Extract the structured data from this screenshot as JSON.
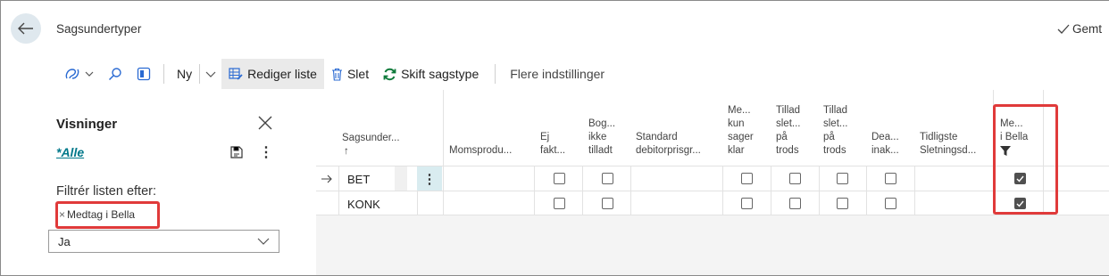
{
  "header": {
    "title": "Sagsundertyper",
    "saved_label": "Gemt"
  },
  "toolbar": {
    "new_label": "Ny",
    "edit_list_label": "Rediger liste",
    "delete_label": "Slet",
    "switch_type_label": "Skift sagstype",
    "more_settings_label": "Flere indstillinger"
  },
  "views": {
    "title": "Visninger",
    "active_view": "*Alle",
    "filter_label": "Filtrér listen efter:",
    "filter_chip": "Medtag i Bella",
    "filter_value": "Ja"
  },
  "columns": [
    {
      "key": "code",
      "label_lines": [
        "Sagsunder...",
        "↑"
      ]
    },
    {
      "key": "moms",
      "label_lines": [
        "Momsprodu..."
      ]
    },
    {
      "key": "ej_fakt",
      "label_lines": [
        "Ej",
        "fakt..."
      ]
    },
    {
      "key": "bog_ikke",
      "label_lines": [
        "Bog...",
        "ikke",
        "tilladt"
      ]
    },
    {
      "key": "std_debitor",
      "label_lines": [
        "Standard",
        "debitorprisgr..."
      ]
    },
    {
      "key": "me_kun",
      "label_lines": [
        "Me...",
        "kun",
        "sager",
        "klar"
      ]
    },
    {
      "key": "tillad_1",
      "label_lines": [
        "Tillad",
        "slet...",
        "på",
        "trods"
      ]
    },
    {
      "key": "tillad_2",
      "label_lines": [
        "Tillad",
        "slet...",
        "på",
        "trods"
      ]
    },
    {
      "key": "dea_inak",
      "label_lines": [
        "Dea...",
        "inak..."
      ]
    },
    {
      "key": "tidligste",
      "label_lines": [
        "Tidligste",
        "Sletningsd..."
      ]
    },
    {
      "key": "me_i_bella",
      "label_lines": [
        "Me...",
        "i Bella"
      ]
    }
  ],
  "rows": [
    {
      "code": "BET",
      "ej_fakt": false,
      "bog_ikke": false,
      "me_kun": false,
      "tillad_1": false,
      "tillad_2": false,
      "dea_inak": false,
      "me_i_bella": true,
      "current": true
    },
    {
      "code": "KONK",
      "ej_fakt": false,
      "bog_ikke": false,
      "me_kun": false,
      "tillad_1": false,
      "tillad_2": false,
      "dea_inak": false,
      "me_i_bella": true,
      "current": false
    }
  ],
  "colors": {
    "accent": "#00788a",
    "highlight_box": "#e03a3a",
    "row_menu_bg": "#d9ecf0"
  }
}
